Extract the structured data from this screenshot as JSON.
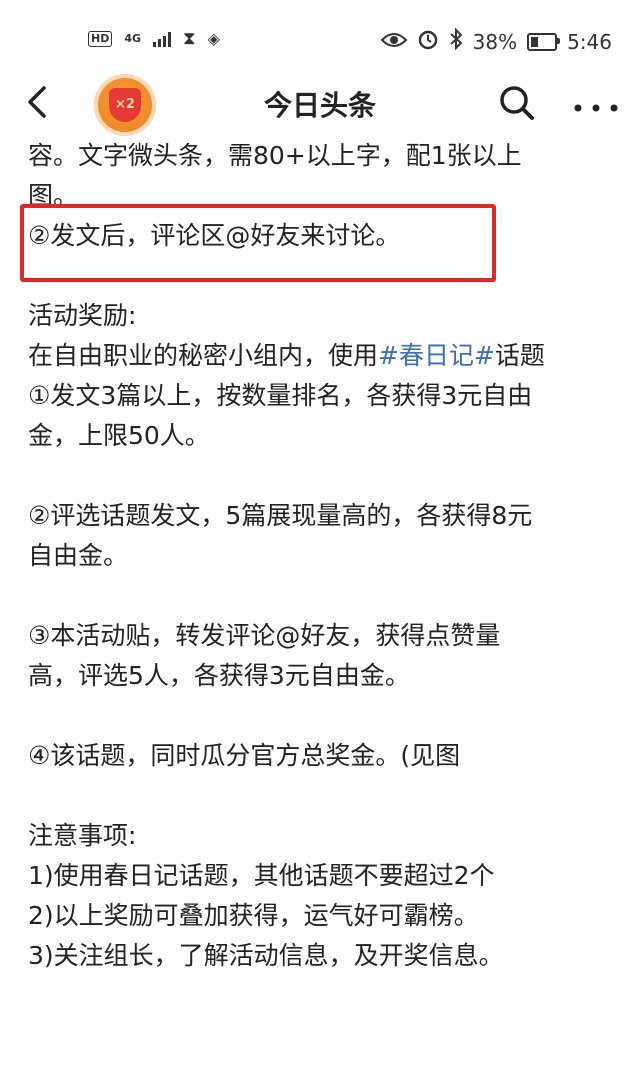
{
  "status_bar": {
    "hd_label": "HD",
    "network_label": "4G",
    "battery_text": "38%",
    "battery_level": 0.38,
    "time": "5:46",
    "icons": [
      "hd-icon",
      "signal-icon",
      "hourglass-icon",
      "nfc-icon",
      "eye-icon",
      "alarm-icon",
      "bluetooth-icon",
      "battery-icon"
    ]
  },
  "nav": {
    "title": "今日头条",
    "badge_text": "×2"
  },
  "content": {
    "lines": [
      "容。文字微头条，需80+以上字，配1张以上",
      "图。",
      "②发文后，评论区@好友来讨论。",
      "",
      "活动奖励:",
      {
        "pre": "在自由职业的秘密小组内，使用",
        "tag": "#春日记#",
        "post": "话题"
      },
      "①发文3篇以上，按数量排名，各获得3元自由",
      "金，上限50人。",
      "",
      "②评选话题发文，5篇展现量高的，各获得8元",
      "自由金。",
      "",
      "③本活动贴，转发评论@好友，获得点赞量",
      "高，评选5人，各获得3元自由金。",
      "",
      "④该话题，同时瓜分官方总奖金。(见图",
      "",
      "注意事项:",
      "1)使用春日记话题，其他话题不要超过2个",
      "2)以上奖励可叠加获得，运气好可霸榜。",
      "3)关注组长，了解活动信息，及开奖信息。"
    ]
  },
  "colors": {
    "accent_tag": "#3b6fb6",
    "highlight_border": "#e3262a"
  }
}
